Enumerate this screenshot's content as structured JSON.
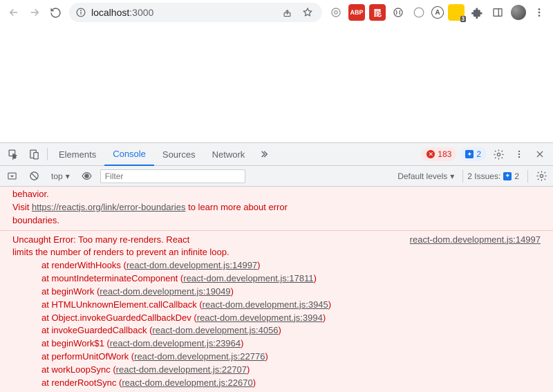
{
  "toolbar": {
    "url_host": "localhost",
    "url_path": ":3000",
    "ext_badge_value": "3"
  },
  "devtools": {
    "tabs": [
      "Elements",
      "Console",
      "Sources",
      "Network"
    ],
    "active_tab": "Console",
    "error_count": "183",
    "info_count": "2",
    "filter": {
      "context": "top",
      "placeholder": "Filter",
      "levels": "Default levels",
      "issues_label": "2 Issues:",
      "issues_count": "2"
    },
    "log": {
      "pre1": "behavior.",
      "pre2a": "Visit ",
      "pre2link": "https://reactjs.org/link/error-boundaries",
      "pre2b": " to learn more about error",
      "pre3": "boundaries.",
      "err_source": "react-dom.development.js:14997",
      "err1": "  Uncaught Error: Too many re-renders. React",
      "err2": "limits the number of renders to prevent an infinite loop.",
      "stack": [
        {
          "fn": "renderWithHooks",
          "file": "react-dom.development.js:14997"
        },
        {
          "fn": "mountIndeterminateComponent",
          "file": "react-dom.development.js:17811"
        },
        {
          "fn": "beginWork",
          "file": "react-dom.development.js:19049"
        },
        {
          "fn": "HTMLUnknownElement.callCallback",
          "file": "react-dom.development.js:3945"
        },
        {
          "fn": "Object.invokeGuardedCallbackDev",
          "file": "react-dom.development.js:3994"
        },
        {
          "fn": "invokeGuardedCallback",
          "file": "react-dom.development.js:4056"
        },
        {
          "fn": "beginWork$1",
          "file": "react-dom.development.js:23964"
        },
        {
          "fn": "performUnitOfWork",
          "file": "react-dom.development.js:22776"
        },
        {
          "fn": "workLoopSync",
          "file": "react-dom.development.js:22707"
        },
        {
          "fn": "renderRootSync",
          "file": "react-dom.development.js:22670"
        }
      ]
    }
  }
}
